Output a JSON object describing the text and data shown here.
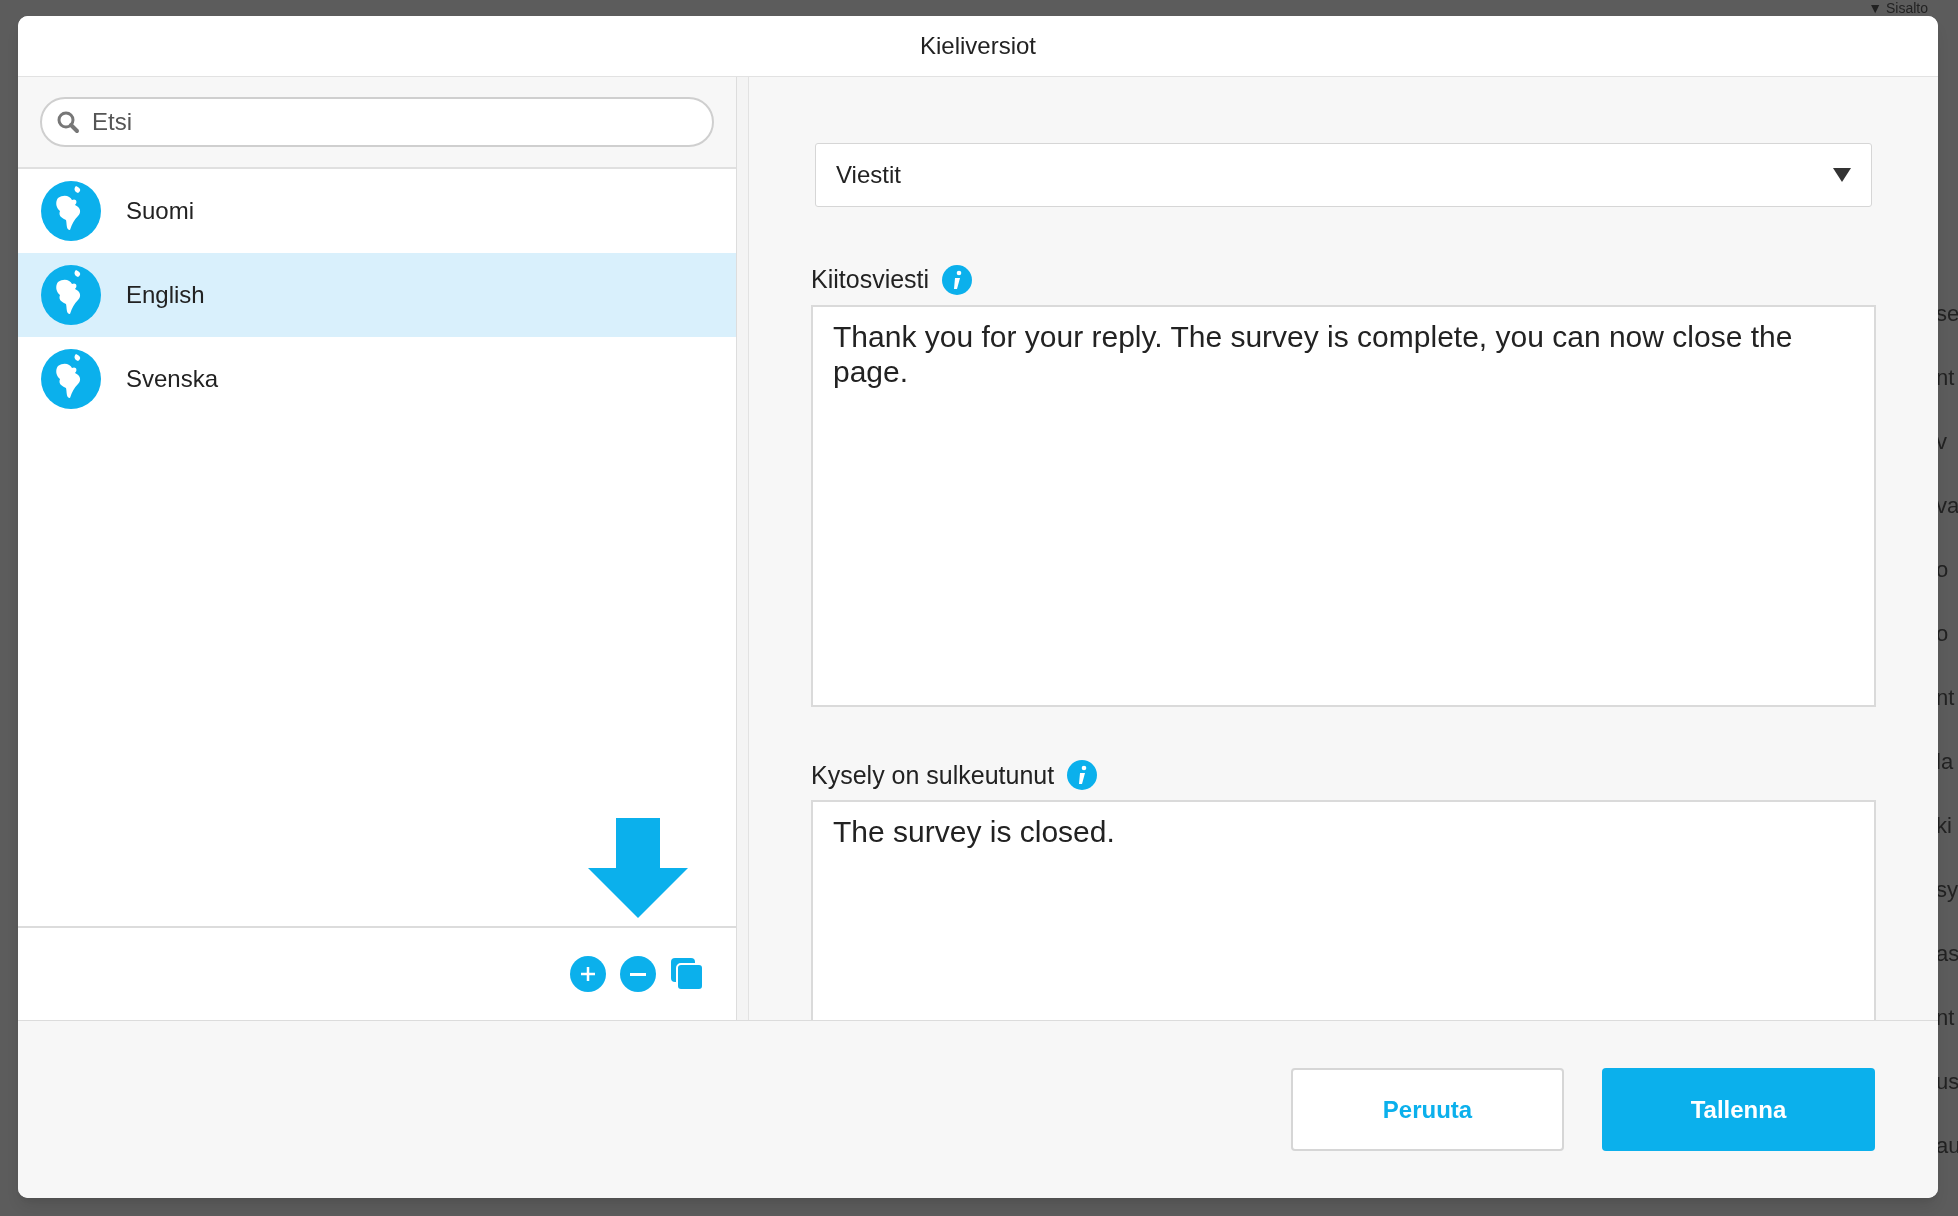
{
  "background": {
    "heading": "▼ Sisalto",
    "fragments": [
      "se",
      "nt",
      "v",
      "va",
      "o",
      "o",
      "nt",
      "la",
      "ki",
      "sy",
      "as",
      "nt",
      "us",
      "au"
    ]
  },
  "dialog": {
    "title": "Kieliversiot"
  },
  "search": {
    "placeholder": "Etsi"
  },
  "languages": [
    {
      "label": "Suomi",
      "selected": false
    },
    {
      "label": "English",
      "selected": true
    },
    {
      "label": "Svenska",
      "selected": false
    }
  ],
  "dropdown": {
    "value": "Viestit"
  },
  "fields": [
    {
      "label": "Kiitosviesti",
      "value": "Thank you for your reply. The survey is complete, you can now close the page."
    },
    {
      "label": "Kysely on sulkeutunut",
      "value": "The survey is closed."
    }
  ],
  "buttons": [
    {
      "label": "Peruuta",
      "kind": "secondary"
    },
    {
      "label": "Tallenna",
      "kind": "primary"
    }
  ]
}
